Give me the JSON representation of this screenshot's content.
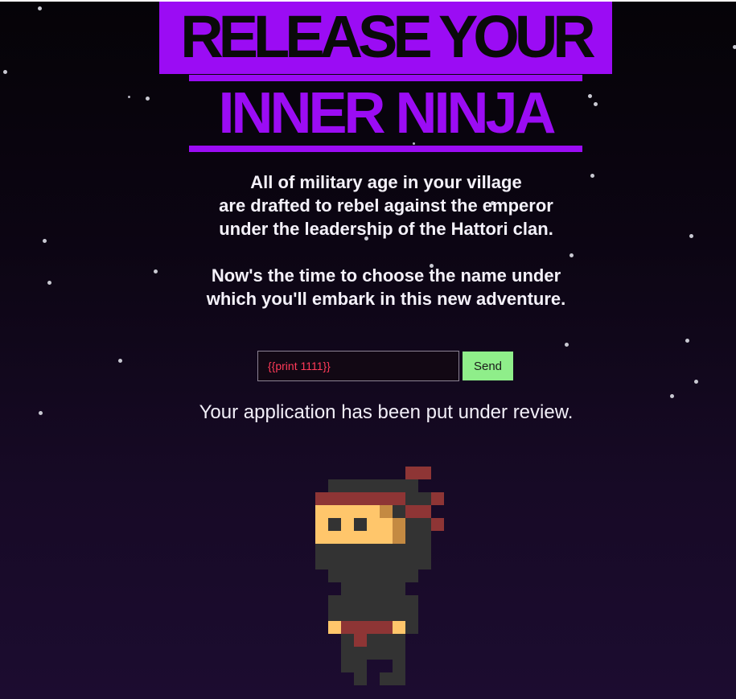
{
  "title": {
    "line1": "RELEASE YOUR",
    "line2": "INNER NINJA"
  },
  "intro": {
    "paragraph1": [
      "All of military age in your village",
      "are drafted to rebel against the emperor",
      "under the leadership of the Hattori clan."
    ],
    "paragraph2": [
      "Now's the time to choose the name under",
      "which you'll embark in this new adventure."
    ]
  },
  "form": {
    "name_value": "{{print 1111}}",
    "send_label": "Send"
  },
  "status": {
    "message": "Your application has been put under review."
  },
  "mascot": {
    "icon": "pixel-ninja-icon"
  },
  "colors": {
    "accent_purple": "#9b0cf4",
    "send_green": "#8fee8a",
    "input_text_red": "#ff3a58",
    "ninja_suit": "#333333",
    "ninja_headband": "#8e3535",
    "ninja_skin": "#ffc66b"
  }
}
